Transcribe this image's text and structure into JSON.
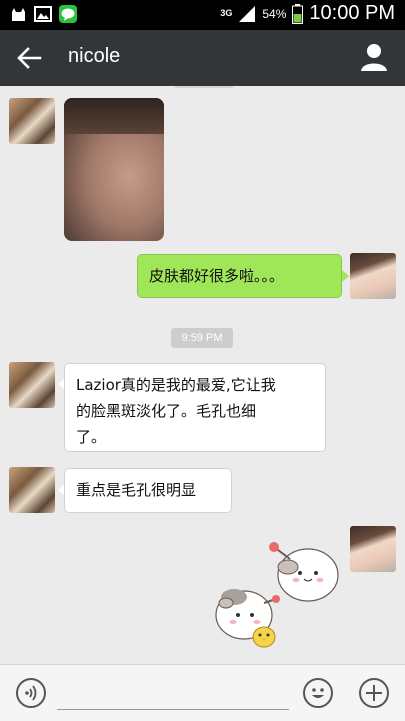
{
  "status_bar": {
    "network": "3G",
    "battery": "54%",
    "time": "10:00 PM",
    "icons": [
      "cat-icon",
      "image-icon",
      "line-app-icon",
      "signal-icon",
      "battery-icon"
    ]
  },
  "header": {
    "title": "nicole",
    "back_icon": "arrow-left-icon",
    "profile_icon": "person-icon"
  },
  "messages": [
    {
      "side": "left",
      "type": "image"
    },
    {
      "side": "right",
      "type": "text",
      "text": "皮肤都好很多啦。。。"
    },
    {
      "type": "timestamp",
      "text": "9:59 PM"
    },
    {
      "side": "left",
      "type": "text",
      "lines": [
        "Lazior真的是我的最爱,它让我",
        "的脸黑斑淡化了。毛孔也细",
        "了。"
      ]
    },
    {
      "side": "left",
      "type": "text",
      "text": "重点是毛孔很明显"
    },
    {
      "side": "right",
      "type": "sticker"
    }
  ],
  "input_bar": {
    "value": "",
    "voice_icon": "voice-icon",
    "emoji_icon": "emoji-icon",
    "plus_icon": "plus-icon"
  },
  "colors": {
    "header_bg": "#323638",
    "chat_bg": "#ebebeb",
    "bubble_sent": "#9fe658",
    "bubble_received": "#ffffff"
  }
}
